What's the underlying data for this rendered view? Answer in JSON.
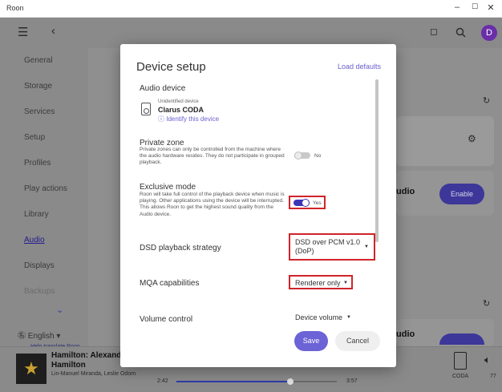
{
  "window": {
    "title": "Roon",
    "minimize": "–",
    "maximize": "☐",
    "close": "✕"
  },
  "topbar": {
    "avatar_initial": "D"
  },
  "sidebar": {
    "items": [
      {
        "label": "General"
      },
      {
        "label": "Storage"
      },
      {
        "label": "Services"
      },
      {
        "label": "Setup"
      },
      {
        "label": "Profiles"
      },
      {
        "label": "Play actions"
      },
      {
        "label": "Library"
      },
      {
        "label": "Audio"
      },
      {
        "label": "Displays"
      },
      {
        "label": "Backups"
      }
    ],
    "active_item": "Audio",
    "language": "English",
    "help_translate": "Help translate Roon"
  },
  "background": {
    "zone_text_1": "udio",
    "zone_text_2": "udio",
    "enable_label": "Enable"
  },
  "now_playing": {
    "title": "Hamilton: Alexande",
    "album": "Hamilton",
    "artists": "Lin-Manuel Miranda, Leslie Odom",
    "elapsed": "2:42",
    "duration": "3:57",
    "progress": 0.71,
    "zone_name": "CODA",
    "volume": "77"
  },
  "modal": {
    "title": "Device setup",
    "load_defaults": "Load defaults",
    "audio_device": {
      "heading": "Audio device",
      "status": "Unidentified device",
      "name": "Clarus CODA",
      "identify_link": "Identify this device"
    },
    "private_zone": {
      "heading": "Private zone",
      "description": "Private zones can only be controlled from the machine where the audio hardware resides. They do not participate in grouped playback.",
      "value": "No"
    },
    "exclusive_mode": {
      "heading": "Exclusive mode",
      "description": "Roon will take full control of the playback device when music is playing. Other applications using the device will be interrupted. This allows Roon to get the highest sound quality from the Audio device.",
      "value": "Yes"
    },
    "dsd_strategy": {
      "label": "DSD playback strategy",
      "value_line1": "DSD over PCM v1.0",
      "value_line2": "(DoP)"
    },
    "mqa": {
      "label": "MQA capabilities",
      "value": "Renderer only"
    },
    "volume_control": {
      "label": "Volume control",
      "value": "Device volume"
    },
    "save_label": "Save",
    "cancel_label": "Cancel"
  },
  "colors": {
    "accent": "#6c63d6",
    "highlight_box": "#d0242a",
    "toggle_on": "#3d35b8"
  }
}
